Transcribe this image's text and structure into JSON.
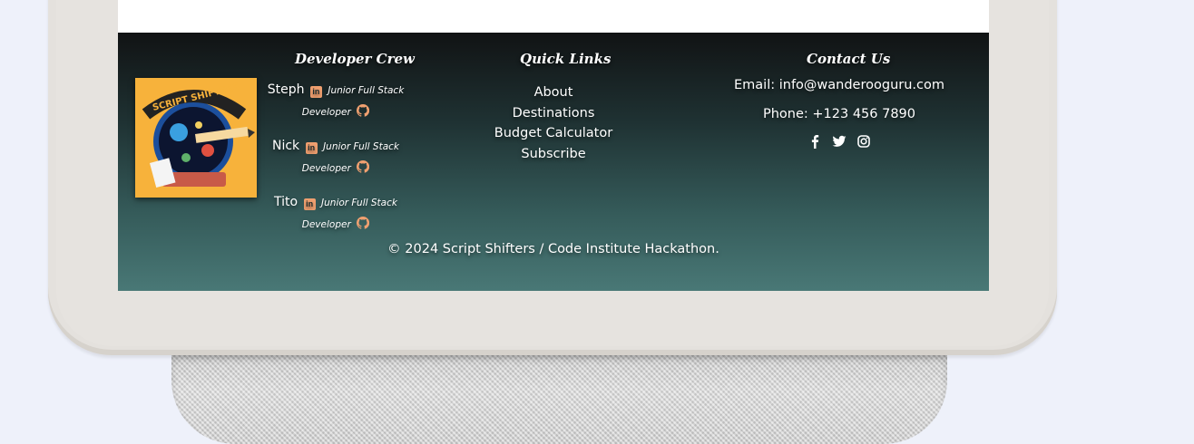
{
  "footer": {
    "logo_text": "SCRIPT SHIFTERS",
    "crew": {
      "title": "Developer Crew",
      "members": [
        {
          "name": "Steph",
          "role": "Junior Full Stack Developer"
        },
        {
          "name": "Nick",
          "role": "Junior Full Stack Developer"
        },
        {
          "name": "Tito",
          "role": "Junior Full Stack Developer"
        }
      ],
      "linkedin_icon_text": "in"
    },
    "quick_links": {
      "title": "Quick Links",
      "items": [
        "About",
        "Destinations",
        "Budget Calculator",
        "Subscribe"
      ]
    },
    "contact": {
      "title": "Contact Us",
      "email": "Email: info@wanderooguru.com",
      "phone": "Phone: +123 456 7890",
      "socials": [
        "facebook-icon",
        "twitter-icon",
        "instagram-icon"
      ]
    },
    "copyright": "© 2024 Script Shifters / Code Institute Hackathon."
  },
  "colors": {
    "page_bg": "#eef1fa",
    "footer_top": "#111314",
    "footer_bottom": "#497876",
    "icon_accent": "#f0a070",
    "logo_bg": "#f7b23b"
  }
}
